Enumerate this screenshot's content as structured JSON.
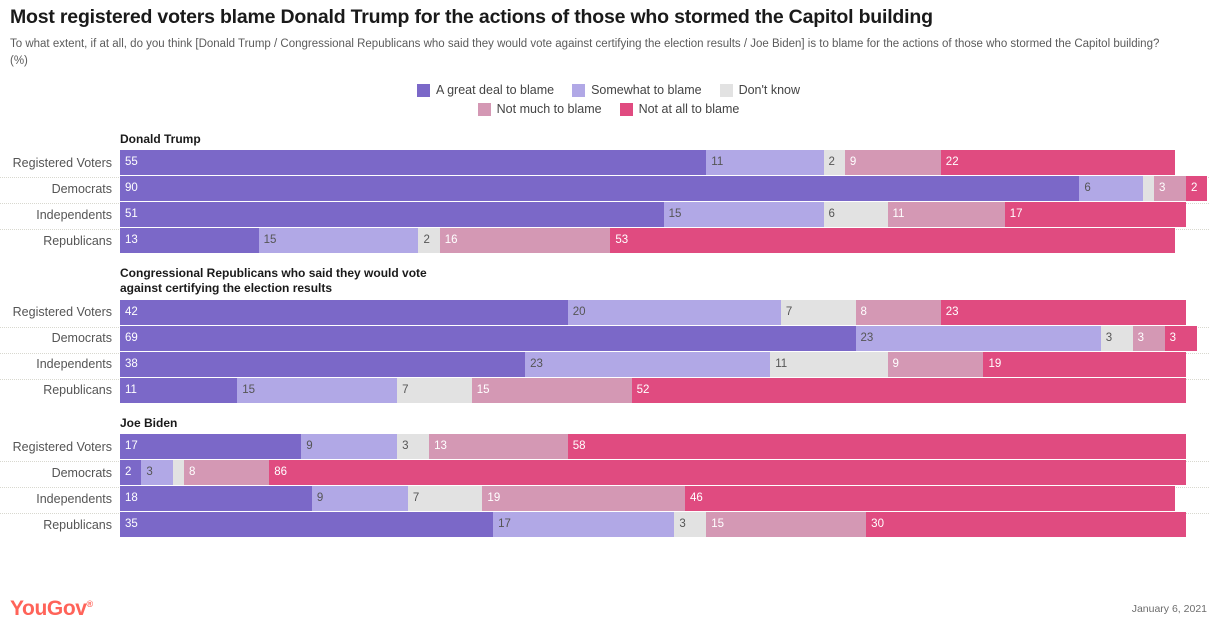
{
  "header": {
    "title": "Most registered voters blame Donald Trump for the actions of those who stormed the Capitol building",
    "subtitle": "To what extent, if at all, do you think [Donald Trump / Congressional Republicans who said they would vote against certifying the election results / Joe Biden] is to blame for the actions of those who stormed the Capitol building? (%)"
  },
  "legend": {
    "row1": [
      {
        "label": "A great deal to blame",
        "color": "#7b68c8"
      },
      {
        "label": "Somewhat to blame",
        "color": "#b1a8e6"
      },
      {
        "label": "Don't know",
        "color": "#e2e2e2"
      }
    ],
    "row2": [
      {
        "label": "Not much to blame",
        "color": "#d498b4"
      },
      {
        "label": "Not at all to blame",
        "color": "#e04b80"
      }
    ]
  },
  "footer": {
    "brand": "YouGov",
    "date": "January 6, 2021"
  },
  "chart_data": {
    "type": "bar",
    "subtype": "stacked-horizontal-100",
    "title": "Most registered voters blame Donald Trump for the actions of those who stormed the Capitol building",
    "subtitle": "To what extent, if at all, do you think [Donald Trump / Congressional Republicans who said they would vote against certifying the election results / Joe Biden] is to blame for the actions of those who stormed the Capitol building? (%)",
    "xlabel": "",
    "ylabel": "",
    "unit": "%",
    "grid": false,
    "legend_position": "top",
    "series": [
      {
        "name": "A great deal to blame",
        "color": "#7b68c8",
        "text": "light"
      },
      {
        "name": "Somewhat to blame",
        "color": "#b1a8e6",
        "text": "dark"
      },
      {
        "name": "Don't know",
        "color": "#e2e2e2",
        "text": "dark"
      },
      {
        "name": "Not much to blame",
        "color": "#d498b4",
        "text": "light"
      },
      {
        "name": "Not at all to blame",
        "color": "#e04b80",
        "text": "light"
      }
    ],
    "groups": [
      {
        "title": "Donald Trump",
        "categories": [
          "Registered Voters",
          "Democrats",
          "Independents",
          "Republicans"
        ],
        "rows": [
          {
            "category": "Registered Voters",
            "values": [
              55,
              11,
              2,
              9,
              22
            ]
          },
          {
            "category": "Democrats",
            "values": [
              90,
              6,
              1,
              3,
              2
            ]
          },
          {
            "category": "Independents",
            "values": [
              51,
              15,
              6,
              11,
              17
            ]
          },
          {
            "category": "Republicans",
            "values": [
              13,
              15,
              2,
              16,
              53
            ]
          }
        ]
      },
      {
        "title": "Congressional Republicans who said they would vote against certifying the election results",
        "categories": [
          "Registered Voters",
          "Democrats",
          "Independents",
          "Republicans"
        ],
        "rows": [
          {
            "category": "Registered Voters",
            "values": [
              42,
              20,
              7,
              8,
              23
            ]
          },
          {
            "category": "Democrats",
            "values": [
              69,
              23,
              3,
              3,
              3
            ]
          },
          {
            "category": "Independents",
            "values": [
              38,
              23,
              11,
              9,
              19
            ]
          },
          {
            "category": "Republicans",
            "values": [
              11,
              15,
              7,
              15,
              52
            ]
          }
        ]
      },
      {
        "title": "Joe Biden",
        "categories": [
          "Registered Voters",
          "Democrats",
          "Independents",
          "Republicans"
        ],
        "rows": [
          {
            "category": "Registered Voters",
            "values": [
              17,
              9,
              3,
              13,
              58
            ]
          },
          {
            "category": "Democrats",
            "values": [
              2,
              3,
              1,
              8,
              86
            ]
          },
          {
            "category": "Independents",
            "values": [
              18,
              9,
              7,
              19,
              46
            ]
          },
          {
            "category": "Republicans",
            "values": [
              35,
              17,
              3,
              15,
              30
            ]
          }
        ]
      }
    ]
  }
}
